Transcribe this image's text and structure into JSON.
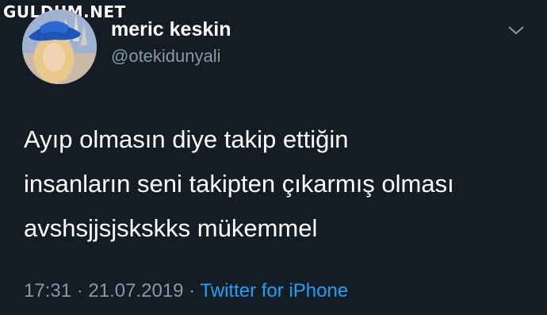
{
  "watermark": "GULDUM.NET",
  "user": {
    "display_name": "meric keskin",
    "handle": "@otekidunyali",
    "avatar_icon": "profile-photo"
  },
  "menu_icon": "chevron-down-icon",
  "tweet": {
    "lines": [
      "Ayıp olmasın diye takip ettiğin",
      "insanların seni takipten çıkarmış olması",
      "avshsjjsjskskks mükemmel"
    ]
  },
  "meta": {
    "time": "17:31",
    "separator1": " · ",
    "date": "21.07.2019",
    "separator2": " · ",
    "source": "Twitter for iPhone"
  },
  "colors": {
    "background": "#141d26",
    "muted": "#8899a6",
    "link": "#1da1f2"
  }
}
